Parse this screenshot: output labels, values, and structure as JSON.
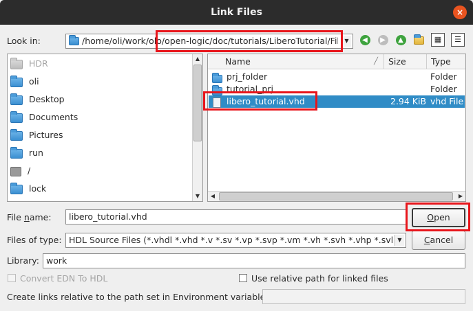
{
  "window": {
    "title": "Link Files",
    "close_glyph": "×"
  },
  "look_in": {
    "label": "Look in:",
    "path": "/home/oli/work/olo/open-logic/doc/tutorials/LiberoTutorial/Files"
  },
  "toolbar": {
    "back_icon": "back-arrow-icon",
    "forward_icon": "forward-arrow-icon",
    "up_icon": "up-arrow-icon",
    "new_folder_icon": "new-folder-icon",
    "list_view_icon": "list-view-icon",
    "detail_view_icon": "detail-view-icon"
  },
  "sidebar": {
    "items": [
      {
        "label": "HDR",
        "icon": "folder-icon",
        "disabled": true
      },
      {
        "label": "oli",
        "icon": "folder-icon"
      },
      {
        "label": "Desktop",
        "icon": "folder-icon"
      },
      {
        "label": "Documents",
        "icon": "folder-icon"
      },
      {
        "label": "Pictures",
        "icon": "folder-icon"
      },
      {
        "label": "run",
        "icon": "folder-icon"
      },
      {
        "label": "/",
        "icon": "drive-icon"
      },
      {
        "label": "lock",
        "icon": "folder-icon"
      }
    ]
  },
  "file_list": {
    "columns": {
      "name": "Name",
      "size": "Size",
      "type": "Type"
    },
    "rows": [
      {
        "name": "prj_folder",
        "size": "",
        "type": "Folder",
        "icon": "folder-icon"
      },
      {
        "name": "tutorial_prj",
        "size": "",
        "type": "Folder",
        "icon": "folder-icon"
      },
      {
        "name": "libero_tutorial.vhd",
        "size": "2.94 KiB",
        "type": "vhd File",
        "icon": "file-icon",
        "selected": true
      }
    ]
  },
  "file_name": {
    "label_pre": "File ",
    "label_u": "n",
    "label_post": "ame:",
    "value": "libero_tutorial.vhd"
  },
  "file_type": {
    "label": "Files of type:",
    "value": "HDL Source Files (*.vhdl *.vhd *.v *.sv *.vp *.svp *.vm *.vh *.svh *.vhp *.svhp *"
  },
  "buttons": {
    "open_u": "O",
    "open_rest": "pen",
    "cancel_u": "C",
    "cancel_rest": "ancel"
  },
  "library": {
    "label": "Library:",
    "value": "work"
  },
  "options": {
    "convert_edn": "Convert EDN To HDL",
    "relative_path": "Use relative path for linked files",
    "env_label": "Create links relative to the path set in Environment variable:",
    "env_value": ""
  },
  "colors": {
    "highlight": "#e8151b",
    "selection": "#308cc6",
    "titlebar": "#2c2c2c",
    "close": "#e95420"
  }
}
